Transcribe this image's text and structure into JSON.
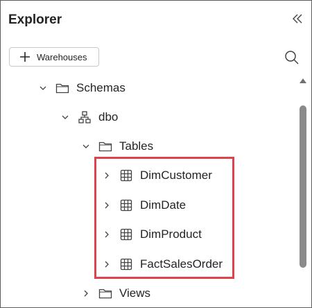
{
  "panel": {
    "title": "Explorer"
  },
  "toolbar": {
    "add_warehouses_label": "Warehouses"
  },
  "tree": {
    "schemas": {
      "label": "Schemas"
    },
    "dbo": {
      "label": "dbo"
    },
    "tables": {
      "label": "Tables"
    },
    "table_items": [
      {
        "label": "DimCustomer"
      },
      {
        "label": "DimDate"
      },
      {
        "label": "DimProduct"
      },
      {
        "label": "FactSalesOrder"
      }
    ],
    "views": {
      "label": "Views"
    }
  },
  "colors": {
    "highlight": "#e0424b",
    "text": "#242424",
    "icon": "#424242"
  },
  "icons": [
    "collapse-icon",
    "plus-icon",
    "search-icon",
    "chevron-down-icon",
    "chevron-right-icon",
    "folder-icon",
    "schema-icon",
    "table-icon"
  ]
}
